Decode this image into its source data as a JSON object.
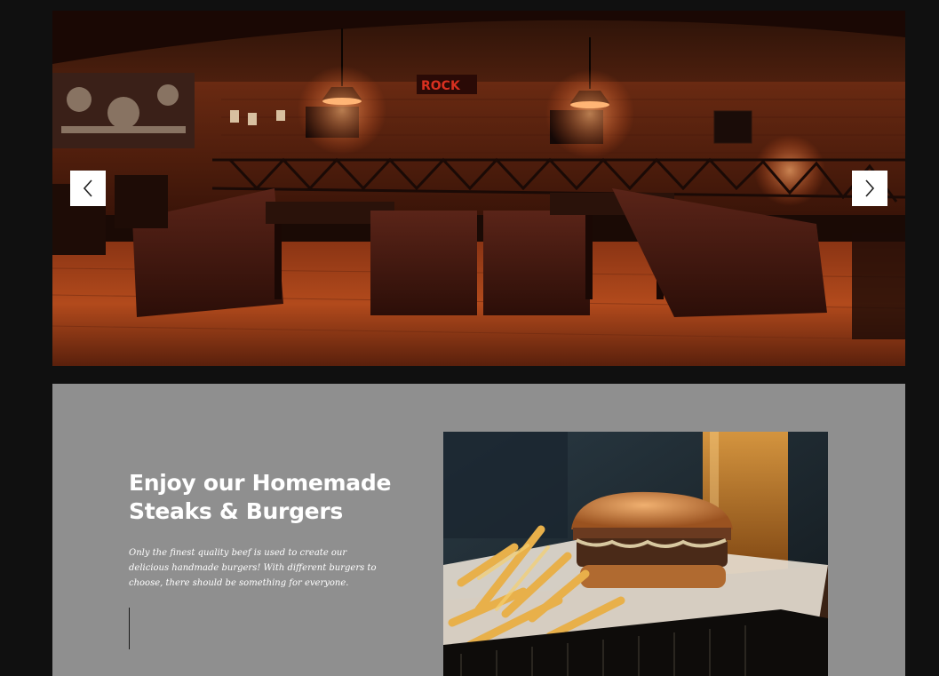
{
  "slider": {
    "image_alt": "Restaurant dining room with leather booths and brick walls",
    "prev_icon": "chevron-left-icon",
    "next_icon": "chevron-right-icon",
    "sign_text": "ROCK"
  },
  "feature": {
    "title_line1": "Enjoy our Homemade",
    "title_line2": "Steaks & Burgers",
    "body": "Only the finest quality beef is used to create our delicious handmade burgers! With different burgers to choose, there should be something for everyone.",
    "photo_alt": "Burger with fries in a basket and a glass of beer"
  },
  "colors": {
    "page_bg": "#101010",
    "section_bg": "#8f8f8f",
    "title": "#ffffff",
    "arrow_bg": "#ffffff"
  }
}
